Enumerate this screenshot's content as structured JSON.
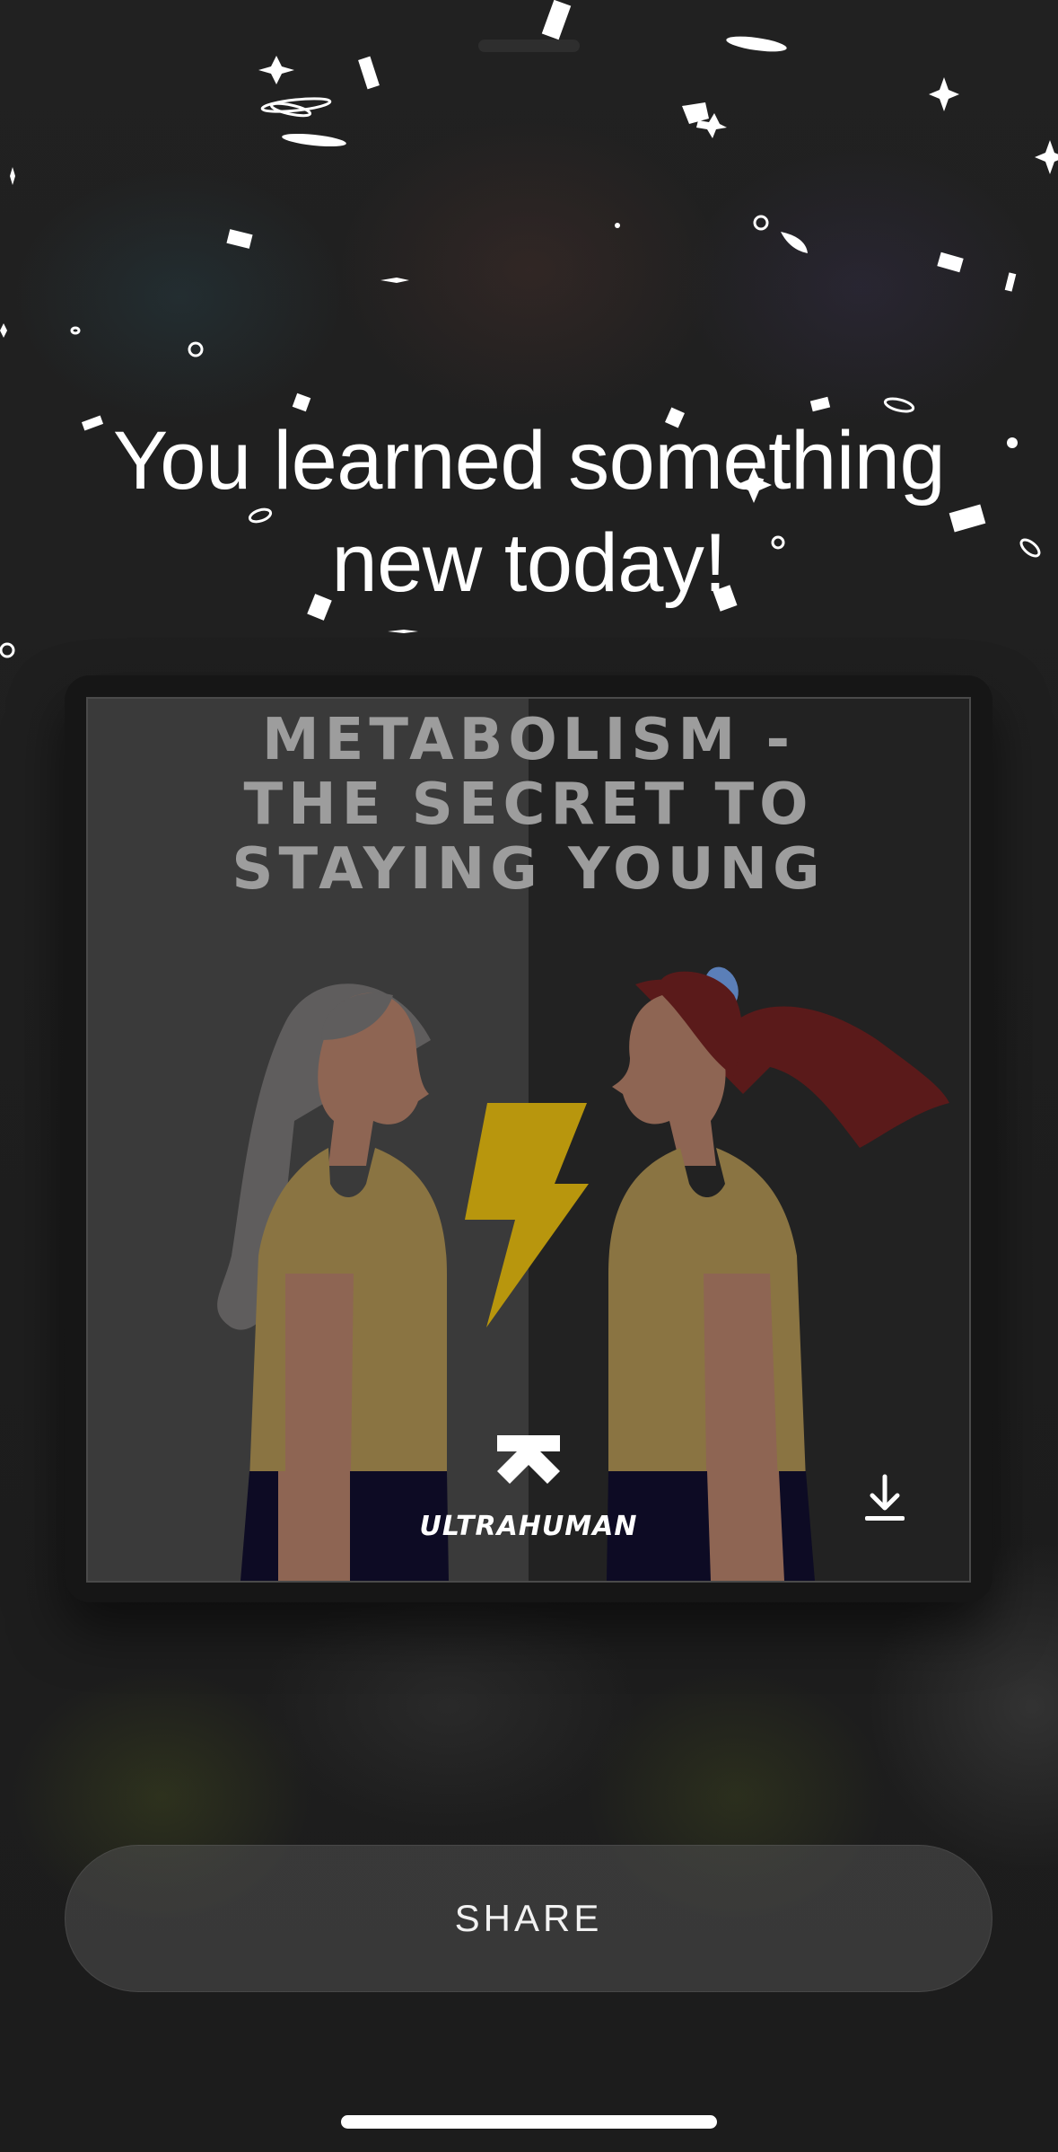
{
  "headline": {
    "line1": "You learned something",
    "line2": "new today!"
  },
  "card": {
    "title_line1": "METABOLISM -",
    "title_line2": "THE SECRET TO",
    "title_line3": "STAYING YOUNG",
    "brand": "ULTRAHUMAN",
    "download_icon": "download-icon",
    "colors": {
      "hair_old": "#5f5d5d",
      "hair_young": "#5a1a1a",
      "skin": "#8e6553",
      "shirt": "#8a7442",
      "pants": "#0d0b24",
      "bolt": "#b8960d"
    }
  },
  "share_button": {
    "label": "SHARE"
  }
}
